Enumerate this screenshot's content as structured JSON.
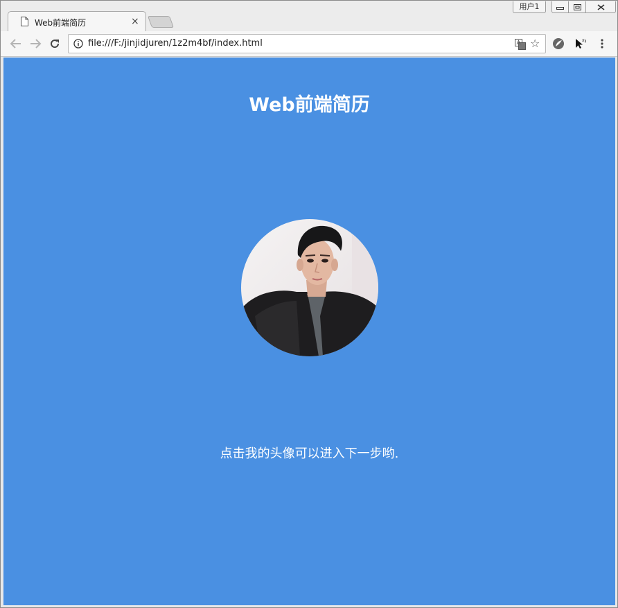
{
  "window": {
    "user_label": "用户1",
    "controls": {
      "minimize": "minimize",
      "maximize": "maximize",
      "close": "close"
    }
  },
  "tab": {
    "title": "Web前端简历",
    "close_glyph": "×"
  },
  "toolbar": {
    "url": "file:///F:/jinjidjuren/1z2m4bf/index.html",
    "icons": [
      "back-icon",
      "forward-icon",
      "reload-icon",
      "info-icon",
      "translate-icon",
      "star-icon",
      "extension-icon",
      "cursor-extension-icon",
      "menu-icon"
    ]
  },
  "page": {
    "background": "#4a90e2",
    "title": "Web前端简历",
    "hint": "点击我的头像可以进入下一步哟."
  }
}
